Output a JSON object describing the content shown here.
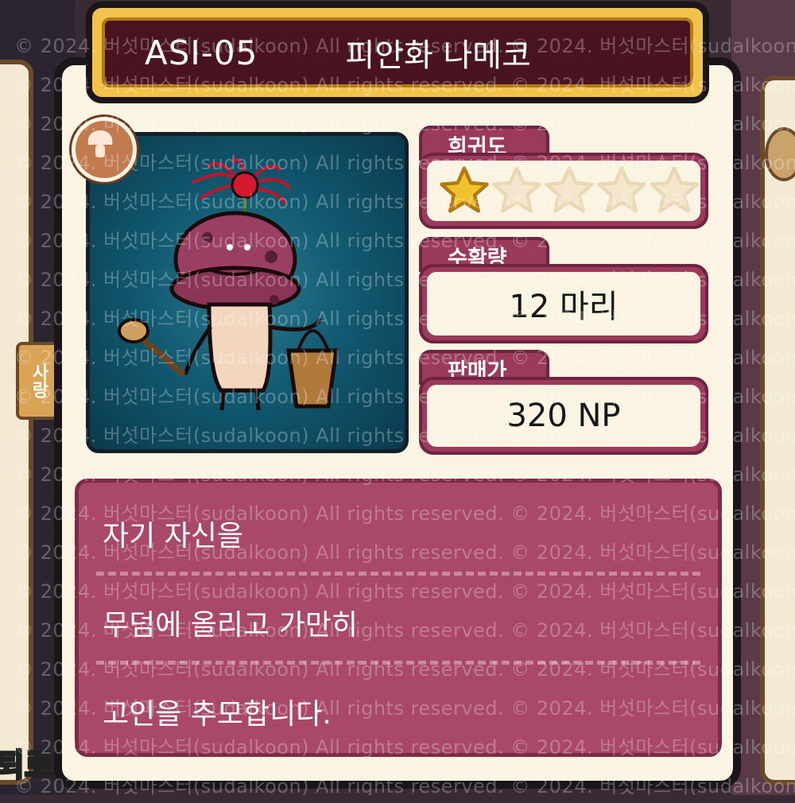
{
  "header": {
    "code": "ASI-05",
    "name": "피안화 나메코"
  },
  "stats": {
    "rarity": {
      "label": "희귀도",
      "filled_stars": 1,
      "total_stars": 5
    },
    "harvest": {
      "label": "수확량",
      "value": "12 마리"
    },
    "price": {
      "label": "판매가",
      "value": "320 NP"
    }
  },
  "description": {
    "lines": [
      "자기 자신을",
      "무덤에 올리고 가만히",
      "고인을 추모합니다."
    ]
  },
  "background": {
    "left_tab": "사랑",
    "bottom_badge": "퇴로"
  },
  "watermark": "© 2024. 버섯마스터(sudalkoon) All rights reserved.",
  "colors": {
    "title_bg": "#4a1320",
    "title_frame": "#f1c34b",
    "stat_tab": "#9b3a5a",
    "description_bg": "#a94867",
    "card_bg": "#fbf4e2",
    "portrait_bg": "#0d4a60",
    "star_filled": "#f2c12e",
    "star_empty": "#f3e6cc"
  },
  "icons": {
    "badge": "mushroom-badge-icon",
    "star_filled": "star-filled-icon",
    "star_empty": "star-empty-icon"
  }
}
